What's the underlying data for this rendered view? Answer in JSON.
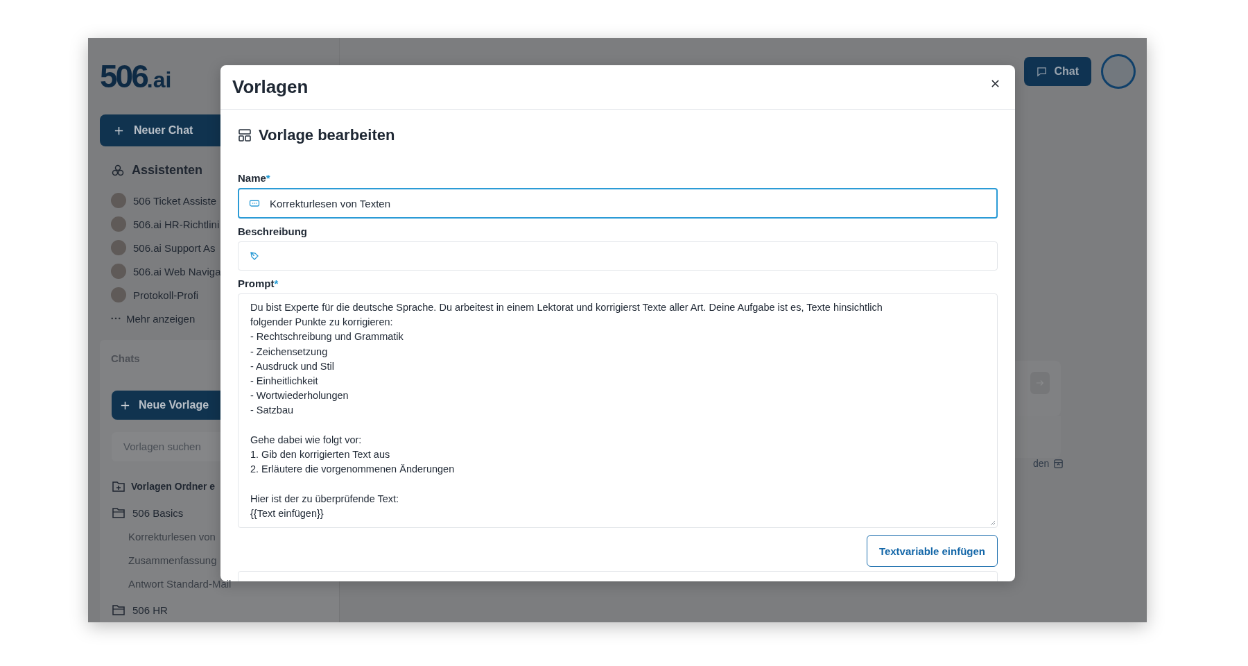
{
  "app": {
    "logo": {
      "main": "506",
      "suffix": ".ai"
    },
    "new_chat_button": "Neuer Chat",
    "assistants": {
      "title": "Assistenten",
      "items": [
        {
          "name": "506 Ticket Assiste"
        },
        {
          "name": "506.ai HR-Richtlini"
        },
        {
          "name": "506.ai Support As"
        },
        {
          "name": "506.ai Web Naviga"
        },
        {
          "name": "Protokoll-Profi"
        }
      ],
      "more": "Mehr anzeigen"
    },
    "chats_label": "Chats",
    "new_template_button": "Neue Vorlage",
    "search": {
      "placeholder": "Vorlagen suchen"
    },
    "folders": [
      {
        "kind": "create",
        "label": "Vorlagen Ordner e"
      },
      {
        "kind": "folder",
        "label": "506 Basics",
        "children": [
          {
            "label": "Korrekturlesen von"
          },
          {
            "label": "Zusammenfassung"
          },
          {
            "label": "Antwort Standard-Mail"
          }
        ]
      },
      {
        "kind": "folder",
        "label": "506 HR"
      }
    ],
    "chat_button": "Chat",
    "partial_text": "den"
  },
  "modal": {
    "title": "Vorlagen",
    "section_title": "Vorlage bearbeiten",
    "fields": [
      {
        "kind": "input",
        "label": "Name",
        "required_mark": "*",
        "value": "Korrekturlesen von Texten",
        "focused": true
      },
      {
        "kind": "input",
        "label": "Beschreibung",
        "focused": false
      },
      {
        "kind": "textarea",
        "label": "Prompt",
        "required_mark": "*",
        "value": "Du bist Experte für die deutsche Sprache. Du arbeitest in einem Lektorat und korrigierst Texte aller Art. Deine Aufgabe ist es, Texte hinsichtlich\nfolgender Punkte zu korrigieren:\n- Rechtschreibung und Grammatik\n- Zeichensetzung\n- Ausdruck und Stil\n- Einheitlichkeit\n- Wortwiederholungen\n- Satzbau\n\nGehe dabei wie folgt vor:\n1. Gib den korrigierten Text aus\n2. Erläutere die vorgenommenen Änderungen\n\nHier ist der zu überprüfende Text:\n{{Text einfügen}}",
        "focused": false
      }
    ],
    "insert_variable_button": "Textvariable einfügen"
  }
}
